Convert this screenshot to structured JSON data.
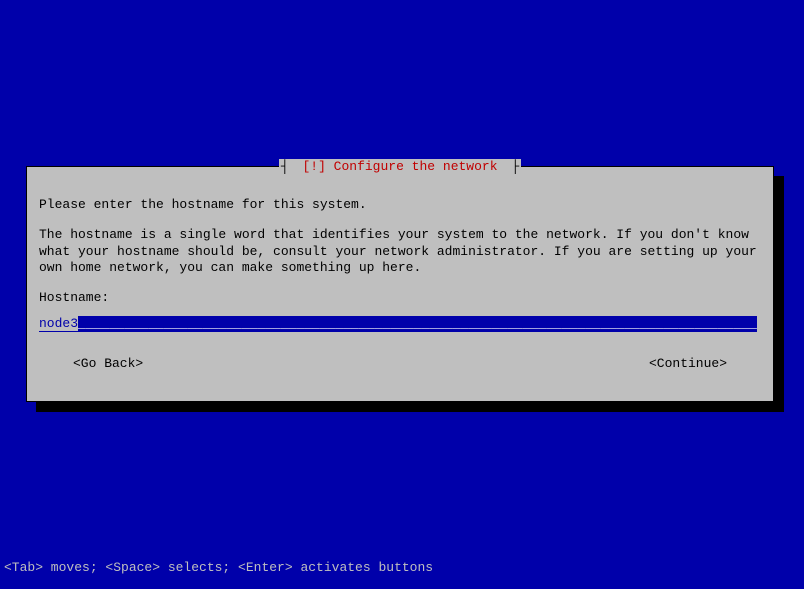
{
  "dialog": {
    "title_prefix": "┤ ",
    "title": "[!] Configure the network",
    "title_suffix": " ├",
    "intro": "Please enter the hostname for this system.",
    "body": "The hostname is a single word that identifies your system to the network. If you don't know what your hostname should be, consult your network administrator. If you are setting up your own home network, you can make something up here.",
    "field_label": "Hostname:",
    "field_value": "node3",
    "fill": "___________________________________________________________________________________________________________________________________",
    "back_label": "<Go Back>",
    "continue_label": "<Continue>"
  },
  "help": "<Tab> moves; <Space> selects; <Enter> activates buttons"
}
